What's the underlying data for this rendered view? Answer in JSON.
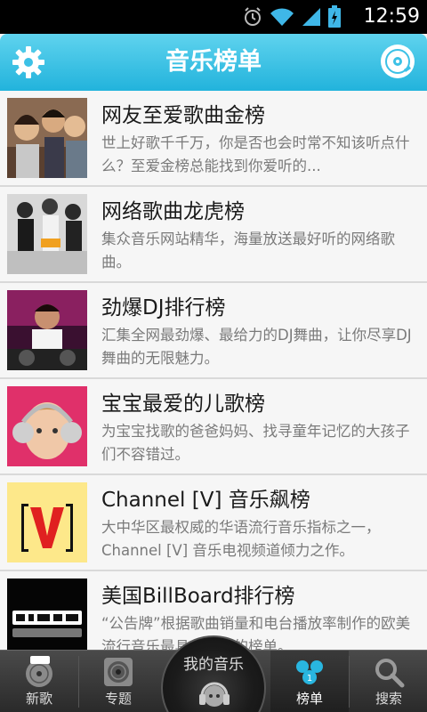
{
  "status_bar": {
    "time": "12:59"
  },
  "header": {
    "title": "音乐榜单"
  },
  "list": [
    {
      "name": "网友至爱歌曲金榜",
      "description": "世上好歌千千万，你是否也会时常不知该听点什么？至爱金榜总能找到你爱听的..."
    },
    {
      "name": "网络歌曲龙虎榜",
      "description": "集众音乐网站精华，海量放送最好听的网络歌曲。"
    },
    {
      "name": "劲爆DJ排行榜",
      "description": "汇集全网最劲爆、最给力的DJ舞曲，让你尽享DJ舞曲的无限魅力。"
    },
    {
      "name": "宝宝最爱的儿歌榜",
      "description": "为宝宝找歌的爸爸妈妈、找寻童年记忆的大孩子们不容错过。"
    },
    {
      "name": "Channel [V] 音乐飙榜",
      "description": "大中华区最权威的华语流行音乐指标之一，Channel [V] 音乐电视频道倾力之作。"
    },
    {
      "name": "美国BillBoard排行榜",
      "description": "“公告牌”根据歌曲销量和电台播放率制作的欧美流行音乐最具公信力的榜单。"
    }
  ],
  "tabs": [
    {
      "label": "新歌",
      "badge": "NEW"
    },
    {
      "label": "专题"
    },
    {
      "label": "榜单"
    },
    {
      "label": "搜索"
    }
  ],
  "center_button": {
    "label": "我的音乐"
  },
  "colors": {
    "header_top": "#5fd3ee",
    "header_bottom": "#22b3dc",
    "active_tab": "#29b6e0"
  }
}
